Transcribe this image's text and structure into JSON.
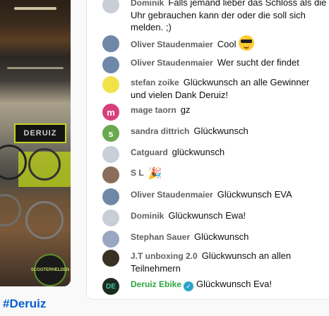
{
  "hashtag": "#Deruiz",
  "video": {
    "sign_text": "DERUIZ",
    "badge_text": "SCOOTERHELDEN"
  },
  "messages": [
    {
      "author": "Dominik",
      "text": "Falls jemand lieber das Schloss als die Uhr gebrauchen kann der oder die soll sich melden. ;)",
      "avatar_color": "#c8cdd6",
      "avatar_letter": ""
    },
    {
      "author": "Oliver Staudenmaier",
      "text": "Cool",
      "avatar_color": "#6f88a8",
      "avatar_letter": "",
      "emoji": "smiling-face-with-sunglasses"
    },
    {
      "author": "Oliver Staudenmaier",
      "text": "Wer sucht der findet",
      "avatar_color": "#6f88a8",
      "avatar_letter": ""
    },
    {
      "author": "stefan zoike",
      "text": "Glückwunsch an alle Gewinner und vielen Dank Deruiz!",
      "avatar_color": "#f2e24a",
      "avatar_letter": ""
    },
    {
      "author": "mage taorn",
      "text": "gz",
      "avatar_color": "#d8407a",
      "avatar_letter": "m"
    },
    {
      "author": "sandra dittrich",
      "text": "Glückwunsch",
      "avatar_color": "#6aa84f",
      "avatar_letter": "s"
    },
    {
      "author": "Catguard",
      "text": "glückwunsch",
      "avatar_color": "#c9cfd9",
      "avatar_letter": ""
    },
    {
      "author": "S L",
      "text": "",
      "avatar_color": "#8a6d5a",
      "avatar_letter": "",
      "emoji": "party-popper"
    },
    {
      "author": "Oliver Staudenmaier",
      "text": "Glückwunsch EVA",
      "avatar_color": "#6f88a8",
      "avatar_letter": ""
    },
    {
      "author": "Dominik",
      "text": "Glückwunsch Ewa!",
      "avatar_color": "#c8cdd6",
      "avatar_letter": ""
    },
    {
      "author": "Stephan Sauer",
      "text": "Glückwunsch",
      "avatar_color": "#9aa7c2",
      "avatar_letter": ""
    },
    {
      "author": "J.T unboxing 2.0",
      "text": "Glückwunsch an allen Teilnehmern",
      "avatar_color": "#3b3024",
      "avatar_letter": ""
    },
    {
      "author": "Deruiz Ebike",
      "text": "Glückwunsch Eva!",
      "avatar_color": "#1d2c1f",
      "avatar_letter": "DE",
      "verified": true,
      "author_color": "#2ba640"
    }
  ]
}
